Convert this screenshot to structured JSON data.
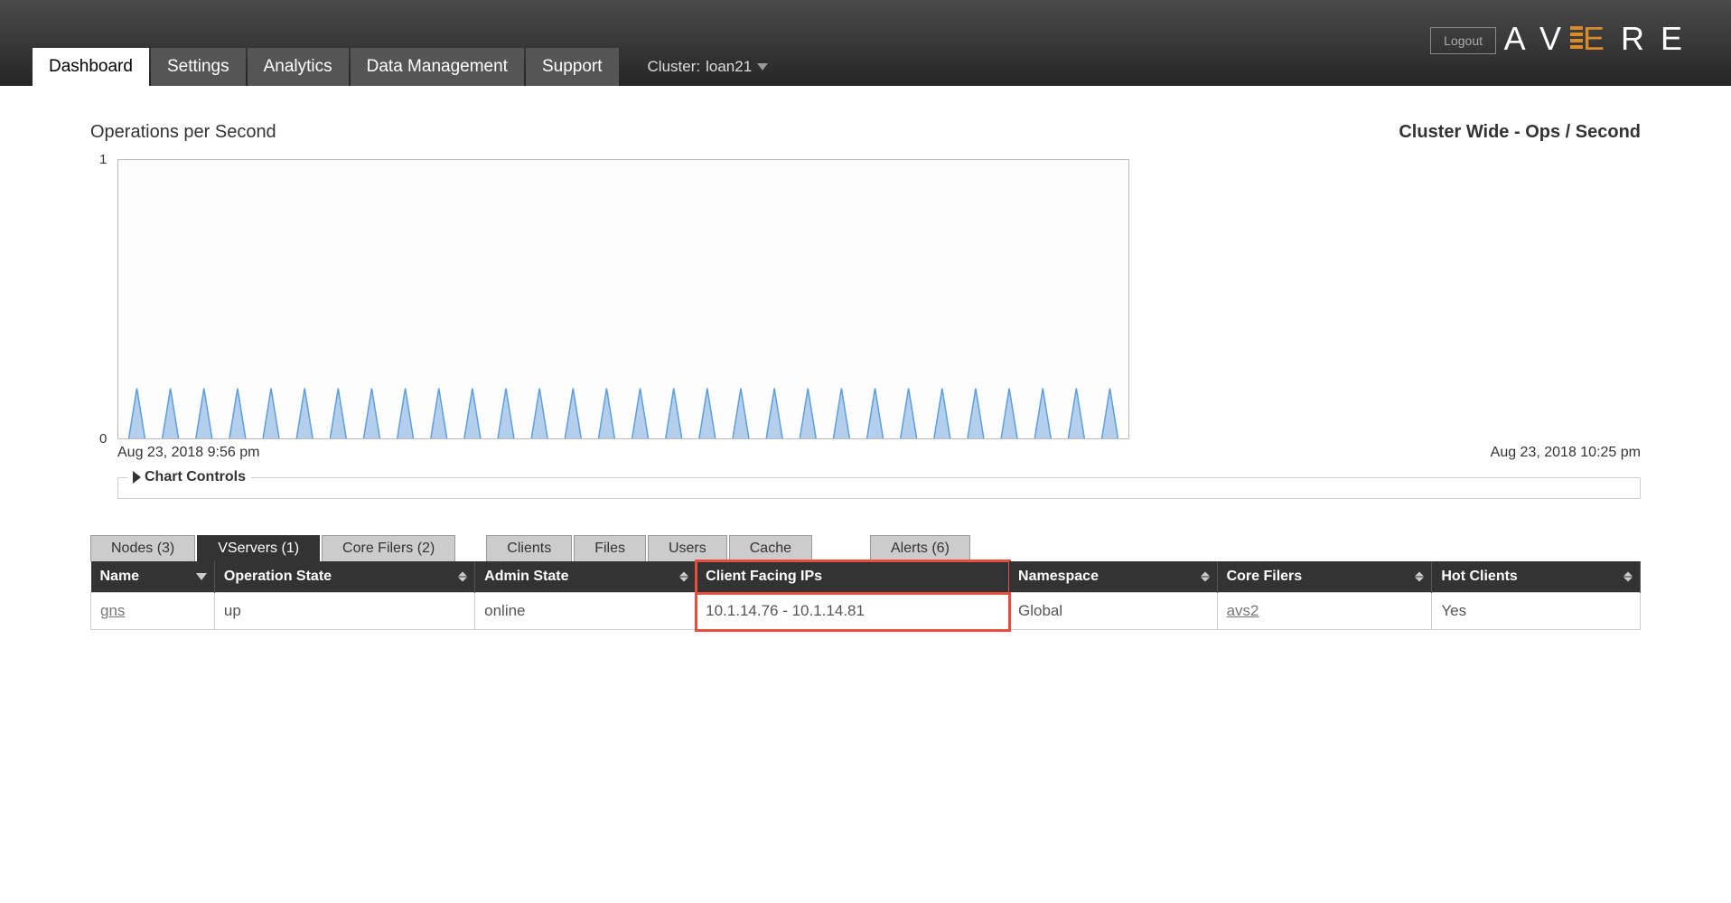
{
  "header": {
    "logout": "Logout",
    "brand_left": "AV",
    "brand_e": "E",
    "brand_right": "RE",
    "cluster_label_prefix": "Cluster: ",
    "cluster_name": "loan21"
  },
  "nav": {
    "tabs": [
      "Dashboard",
      "Settings",
      "Analytics",
      "Data Management",
      "Support"
    ],
    "active_index": 0
  },
  "chart": {
    "title_left": "Operations per Second",
    "title_right": "Cluster Wide - Ops / Second",
    "y_max": "1",
    "y_min": "0",
    "x_start": "Aug 23, 2018 9:56 pm",
    "x_end": "Aug 23, 2018 10:25 pm",
    "controls_label": "Chart Controls"
  },
  "chart_data": {
    "type": "line",
    "title": "Operations per Second — Cluster Wide - Ops / Second",
    "xlabel": "",
    "ylabel": "",
    "ylim": [
      0,
      1
    ],
    "x_range": [
      "Aug 23, 2018 9:56 pm",
      "Aug 23, 2018 10:25 pm"
    ],
    "note": "Approximately 30 narrow periodic spikes rising from 0 to ~0.18 over the 29-minute window; baseline is 0.",
    "spike_count": 30,
    "spike_approx_peak": 0.18
  },
  "lower_tabs": {
    "group1": [
      {
        "label": "Nodes (3)",
        "active": false
      },
      {
        "label": "VServers (1)",
        "active": true
      },
      {
        "label": "Core Filers (2)",
        "active": false
      }
    ],
    "group2": [
      {
        "label": "Clients",
        "active": false
      },
      {
        "label": "Files",
        "active": false
      },
      {
        "label": "Users",
        "active": false
      },
      {
        "label": "Cache",
        "active": false
      }
    ],
    "group3": [
      {
        "label": "Alerts (6)",
        "active": false
      }
    ]
  },
  "table": {
    "columns": [
      "Name",
      "Operation State",
      "Admin State",
      "Client Facing IPs",
      "Namespace",
      "Core Filers",
      "Hot Clients"
    ],
    "sort_column_index": 0,
    "sort_direction": "desc",
    "highlight_column_index": 3,
    "rows": [
      {
        "name": "gns",
        "operation_state": "up",
        "admin_state": "online",
        "client_facing_ips": "10.1.14.76 - 10.1.14.81",
        "namespace": "Global",
        "core_filers": "avs2",
        "hot_clients": "Yes"
      }
    ]
  }
}
